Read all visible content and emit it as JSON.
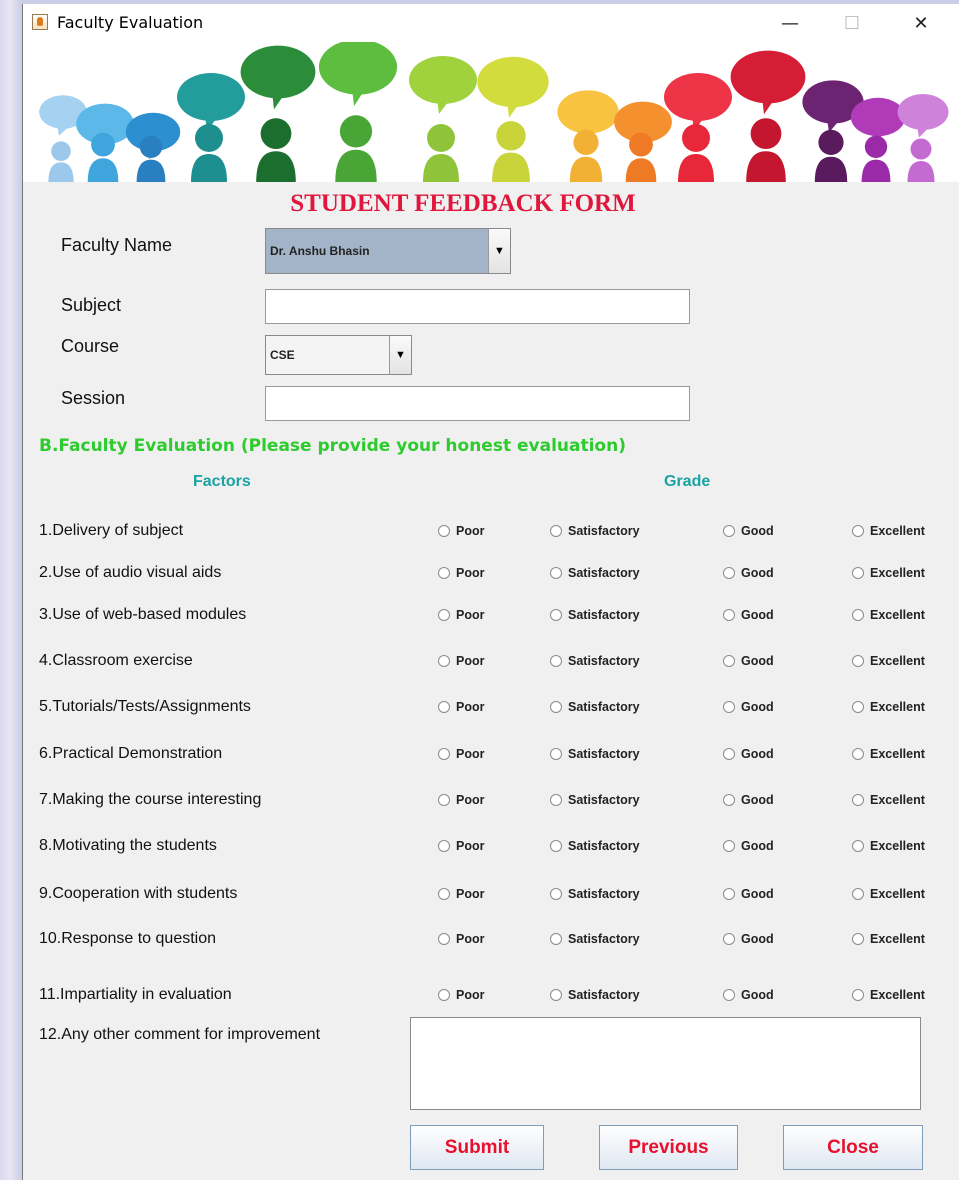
{
  "window": {
    "title": "Faculty Evaluation",
    "minimize_symbol": "—",
    "maximize_symbol": "☐",
    "close_symbol": "✕"
  },
  "form": {
    "title": "STUDENT FEEDBACK FORM",
    "faculty_name_label": "Faculty Name",
    "faculty_name_value": "Dr. Anshu Bhasin",
    "subject_label": "Subject",
    "subject_value": "",
    "course_label": "Course",
    "course_value": "CSE",
    "session_label": "Session",
    "session_value": ""
  },
  "evaluation": {
    "section_title": "B.Faculty Evaluation (Please provide your honest evaluation)",
    "factors_header": "Factors",
    "grade_header": "Grade",
    "options": [
      "Poor",
      "Satisfactory",
      "Good",
      "Excellent"
    ],
    "factors": [
      "1.Delivery of subject",
      "2.Use of audio visual aids",
      "3.Use of web-based modules",
      "4.Classroom exercise",
      "5.Tutorials/Tests/Assignments",
      "6.Practical Demonstration",
      "7.Making the course interesting",
      "8.Motivating the students",
      "9.Cooperation with students",
      "10.Response to question",
      "11.Impartiality in evaluation"
    ],
    "comment_label": "12.Any other comment for improvement",
    "comment_value": ""
  },
  "buttons": {
    "submit": "Submit",
    "previous": "Previous",
    "close": "Close"
  },
  "icons": {
    "app": "java-cup-icon",
    "dropdown": "triangle-down-icon"
  },
  "colors": {
    "form_title": "#e0173d",
    "section_title": "#2dcb2d",
    "column_headers": "#1aa3a3",
    "button_text": "#e8112d",
    "faculty_combo_bg": "#a3b4c8"
  }
}
